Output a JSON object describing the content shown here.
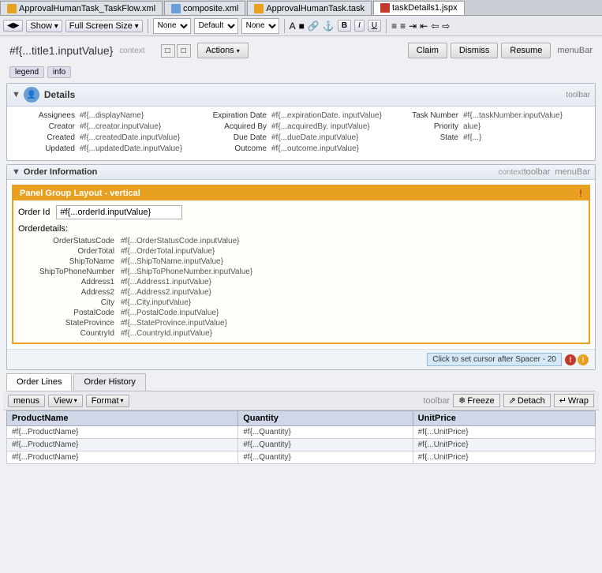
{
  "tabs": [
    {
      "id": "tab1",
      "label": "ApprovalHumanTask_TaskFlow.xml",
      "active": false,
      "icon": "orange"
    },
    {
      "id": "tab2",
      "label": "composite.xml",
      "active": false,
      "icon": "blue"
    },
    {
      "id": "tab3",
      "label": "ApprovalHumanTask.task",
      "active": false,
      "icon": "orange"
    },
    {
      "id": "tab4",
      "label": "taskDetails1.jspx",
      "active": true,
      "icon": "red"
    }
  ],
  "toolbar": {
    "show_label": "Show",
    "fullscreen_label": "Full Screen Size",
    "none_label": "None",
    "default_label": "Default",
    "none2_label": "None"
  },
  "header": {
    "title": "#f{...title1.inputValue}",
    "context_label": "context",
    "actions_label": "Actions",
    "claim_label": "Claim",
    "dismiss_label": "Dismiss",
    "resume_label": "Resume",
    "menubar_label": "menuBar"
  },
  "legend_tabs": [
    "legend",
    "info"
  ],
  "details": {
    "title": "Details",
    "toolbar_label": "toolbar",
    "fields": {
      "assignees_label": "Assignees",
      "assignees_value": "#f{...displayName}",
      "creator_label": "Creator",
      "creator_value": "#f{...creator.inputValue}",
      "created_label": "Created",
      "created_value": "#f{...createdDate.inputValue}",
      "updated_label": "Updated",
      "updated_value": "#f{...updatedDate.inputValue}",
      "expiration_date_label": "Expiration Date",
      "expiration_value": "#f{...expirationDate. inputValue}",
      "acquired_by_label": "Acquired By",
      "acquired_by_value": "#f{...acquiredBy. inputValue}",
      "due_date_label": "Due Date",
      "due_date_value": "#f{...dueDate.inputValue}",
      "outcome_label": "Outcome",
      "outcome_value": "#f{...outcome.inputValue}",
      "task_number_label": "Task Number",
      "task_number_value": "#f{...taskNumber.inputValue}",
      "priority_label": "Priority",
      "priority_value": "alue}",
      "state_label": "State",
      "state_value": "#f{...}"
    }
  },
  "order_section": {
    "title": "Order Information",
    "context_label": "context",
    "toolbar_label": "toolbar",
    "menubar_label": "menuBar",
    "panel_group_title": "Panel Group Layout - vertical",
    "order_id_label": "Order Id",
    "order_id_value": "#f{...orderId.inputValue}",
    "order_details_title": "Orderdetails:",
    "fields": [
      {
        "label": "OrderStatusCode",
        "value": "#f{...OrderStatusCode.inputValue}"
      },
      {
        "label": "OrderTotal",
        "value": "#f{...OrderTotal.inputValue}"
      },
      {
        "label": "ShipToName",
        "value": "#f{...ShipToName.inputValue}"
      },
      {
        "label": "ShipToPhoneNumber",
        "value": "#f{...ShipToPhoneNumber.inputValue}"
      },
      {
        "label": "Address1",
        "value": "#f{...Address1.inputValue}"
      },
      {
        "label": "Address2",
        "value": "#f{...Address2.inputValue}"
      },
      {
        "label": "City",
        "value": "#f{...City.inputValue}"
      },
      {
        "label": "PostalCode",
        "value": "#f{...PostalCode.inputValue}"
      },
      {
        "label": "StateProvince",
        "value": "#f{...StateProvince.inputValue}"
      },
      {
        "label": "CountryId",
        "value": "#f{...CountryId.inputValue}"
      }
    ]
  },
  "spacer": {
    "text": "Click to set cursor after Spacer - 20"
  },
  "order_lines": {
    "tabs": [
      {
        "label": "Order Lines",
        "active": true
      },
      {
        "label": "Order History",
        "active": false
      }
    ],
    "toolbar": {
      "menus_label": "menus",
      "view_label": "View",
      "format_label": "Format",
      "toolbar_label": "toolbar",
      "freeze_label": "Freeze",
      "detach_label": "Detach",
      "wrap_label": "Wrap"
    },
    "table": {
      "headers": [
        "ProductName",
        "Quantity",
        "UnitPrice"
      ],
      "rows": [
        [
          "#f{...ProductName}",
          "#f{...Quantity}",
          "#f{...UnitPrice}"
        ],
        [
          "#f{...ProductName}",
          "#f{...Quantity}",
          "#f{...UnitPrice}"
        ],
        [
          "#f{...ProductName}",
          "#f{...Quantity}",
          "#f{...UnitPrice}"
        ]
      ]
    }
  }
}
